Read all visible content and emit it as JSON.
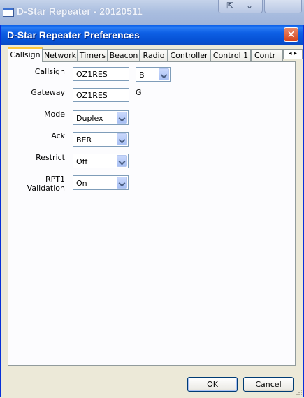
{
  "main_window": {
    "title": "D-Star Repeater - 20120511",
    "controls": [
      "⇱",
      "⌄"
    ]
  },
  "dialog": {
    "title": "D-Star Repeater Preferences",
    "close_label": "✕"
  },
  "tabs": [
    "Callsign",
    "Network",
    "Timers",
    "Beacon",
    "Radio",
    "Controller",
    "Control 1",
    "Contr"
  ],
  "tab_scroll": "◂ ▸",
  "form": {
    "callsign": {
      "label": "Callsign",
      "value": "OZ1RES",
      "module": "B"
    },
    "gateway": {
      "label": "Gateway",
      "value": "OZ1RES",
      "module": "G"
    },
    "mode": {
      "label": "Mode",
      "value": "Duplex"
    },
    "ack": {
      "label": "Ack",
      "value": "BER"
    },
    "restrict": {
      "label": "Restrict",
      "value": "Off"
    },
    "rpt1_validation": {
      "label": "RPT1 Validation",
      "value": "On"
    }
  },
  "buttons": {
    "ok": "OK",
    "cancel": "Cancel"
  }
}
